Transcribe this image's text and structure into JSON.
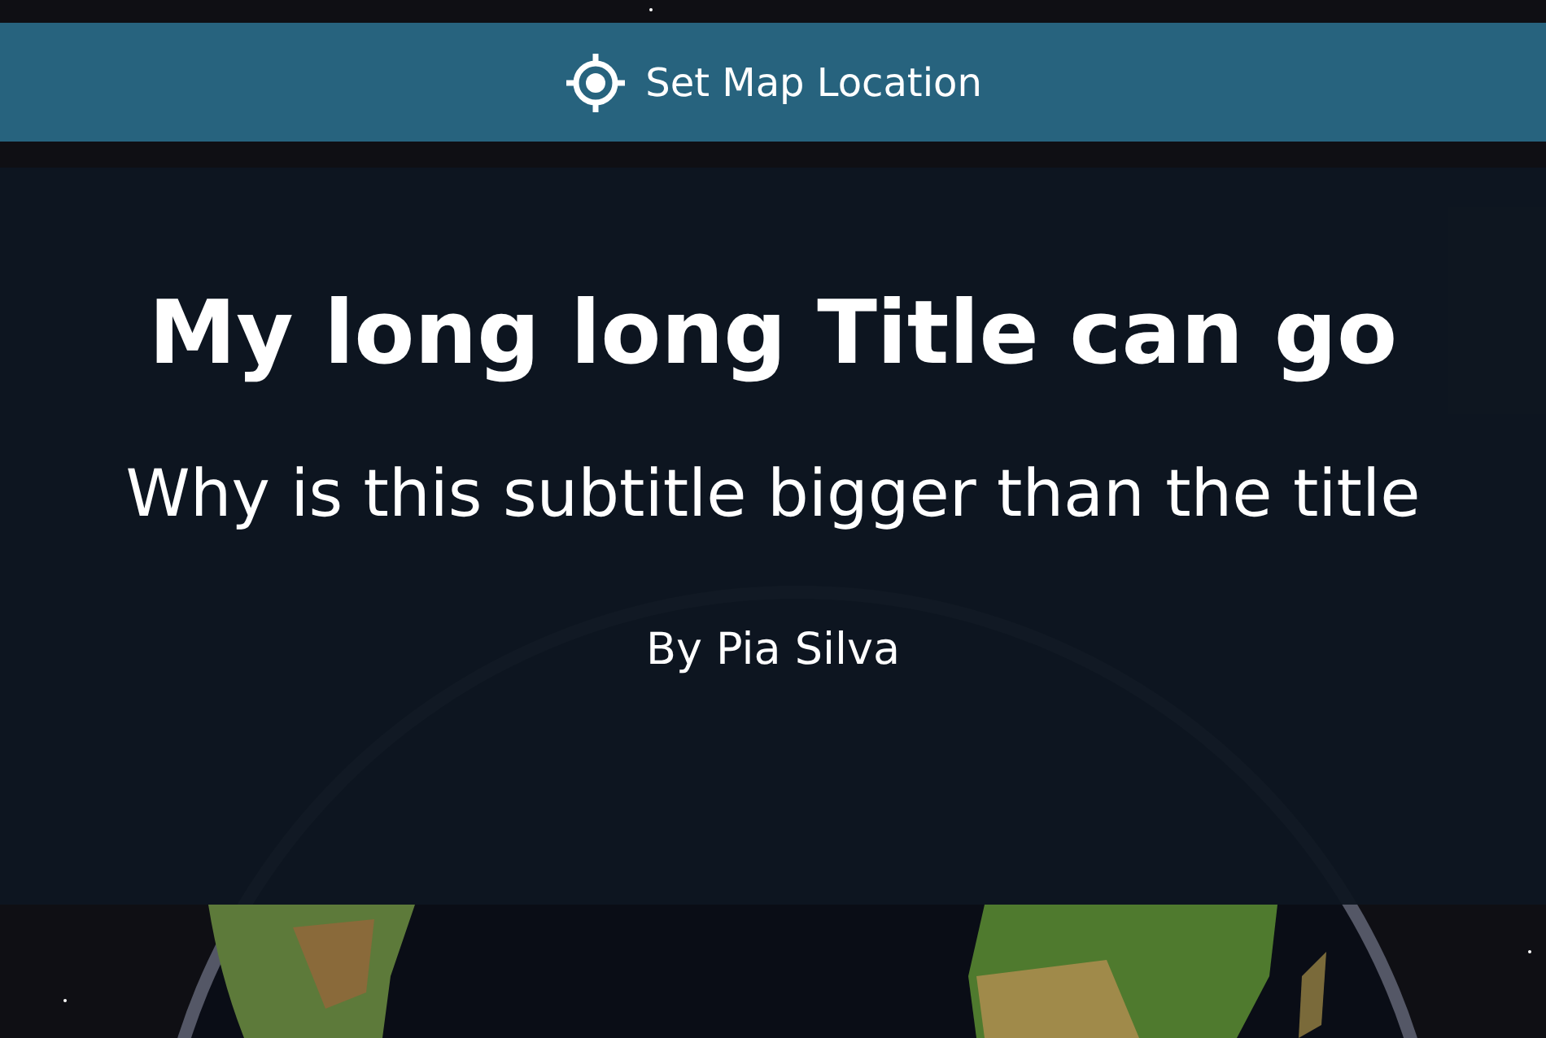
{
  "location_button": {
    "label": "Set Map Location"
  },
  "story": {
    "title": "My long long Title can go",
    "subtitle": "Why is this subtitle bigger than the title",
    "byline": "By Pia Silva"
  }
}
